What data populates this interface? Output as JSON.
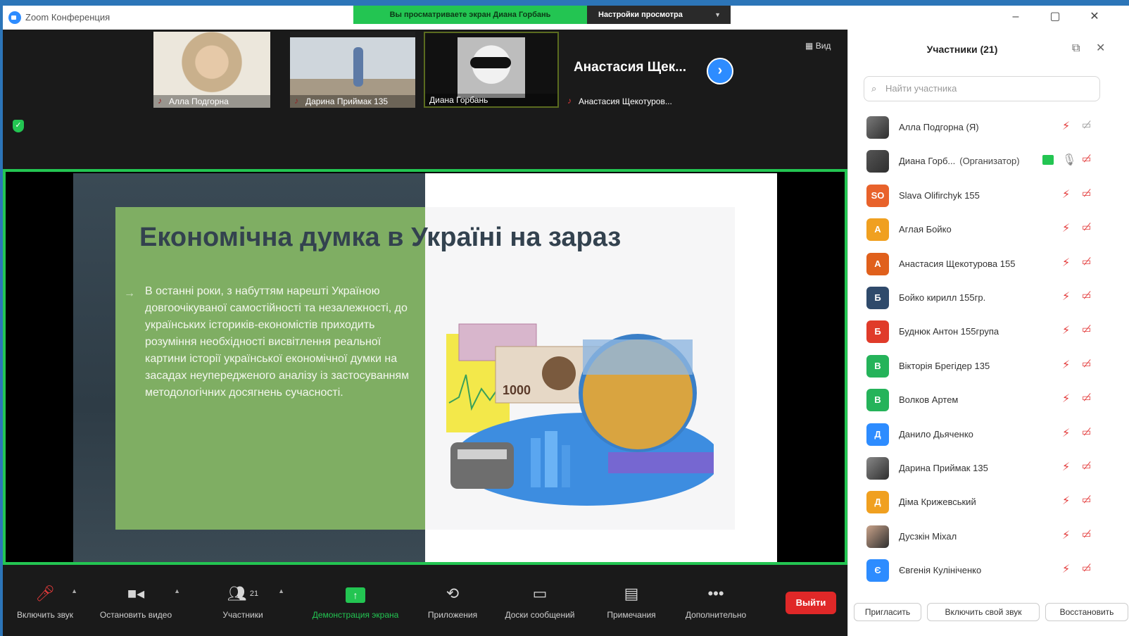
{
  "window": {
    "title": "Zoom Конференция",
    "view_banner": "Вы просматриваете экран Диана Горбань",
    "view_settings": "Настройки просмотра"
  },
  "video_strip": {
    "participants": [
      {
        "name": "Алла Подгорна"
      },
      {
        "name": "Дарина Приймак 135"
      },
      {
        "name": "Диана Горбань"
      },
      {
        "name": "Анастасия Щекотуров...",
        "display_name": "Анастасия  Щек..."
      }
    ],
    "view_label": "Вид"
  },
  "slide": {
    "title": "Економічна думка в Україні на зараз",
    "body": "В останні роки, з набуттям нарешті Україною довгоочікуваної самостійності та незалежності, до українських істориків-економістів приходить розуміння необхідності висвітлення реальної картини історії української економічної думки на засадах неупередженого аналізу із застосуванням методологічних досягнень сучасності.",
    "banknote_label": "1000"
  },
  "toolbar": {
    "items": [
      {
        "label": "Включить звук",
        "icon": "mic-muted-icon"
      },
      {
        "label": "Остановить видео",
        "icon": "video-camera-icon"
      },
      {
        "label": "Участники",
        "icon": "participants-icon",
        "count": "21"
      },
      {
        "label": "Демонстрация экрана",
        "icon": "share-screen-icon"
      },
      {
        "label": "Приложения",
        "icon": "apps-icon"
      },
      {
        "label": "Доски сообщений",
        "icon": "whiteboard-icon"
      },
      {
        "label": "Примечания",
        "icon": "notes-icon"
      },
      {
        "label": "Дополнительно",
        "icon": "more-icon"
      }
    ],
    "leave": "Выйти"
  },
  "panel": {
    "title": "Участники (21)",
    "search_placeholder": "Найти участника",
    "participants": [
      {
        "name": "Алла Подгорна (Я)",
        "avatar": "photo",
        "color": "#7a7a7a",
        "initial": ""
      },
      {
        "name": "Диана Горб...",
        "tag": "(Организатор)",
        "avatar": "photo",
        "color": "#555555",
        "initial": ""
      },
      {
        "name": "Slava Olifirchyk 155",
        "avatar": "initials",
        "color": "#e8622b",
        "initial": "SO"
      },
      {
        "name": "Аглая Бойко",
        "avatar": "initials",
        "color": "#f0a020",
        "initial": "А"
      },
      {
        "name": "Анастасия Щекотурова 155",
        "avatar": "initials",
        "color": "#e0601c",
        "initial": "А"
      },
      {
        "name": "Бойко кирилл 155гр.",
        "avatar": "initials",
        "color": "#2f4a6b",
        "initial": "Б"
      },
      {
        "name": "Буднюк Антон 155група",
        "avatar": "initials",
        "color": "#e03b2a",
        "initial": "Б"
      },
      {
        "name": "Вікторія Брегідер 135",
        "avatar": "initials",
        "color": "#25b35a",
        "initial": "В"
      },
      {
        "name": "Волков Артем",
        "avatar": "initials",
        "color": "#25b35a",
        "initial": "В"
      },
      {
        "name": "Данило Дьяченко",
        "avatar": "initials",
        "color": "#2d8cff",
        "initial": "Д"
      },
      {
        "name": "Дарина Приймак 135",
        "avatar": "photo",
        "color": "#888888",
        "initial": ""
      },
      {
        "name": "Діма Крижевський",
        "avatar": "initials",
        "color": "#f0a020",
        "initial": "Д"
      },
      {
        "name": "Дусзкін Міхал",
        "avatar": "photo",
        "color": "#c9a38a",
        "initial": ""
      },
      {
        "name": "Євгенія Кулініченко",
        "avatar": "initials",
        "color": "#2d8cff",
        "initial": "Є"
      }
    ],
    "footer": {
      "invite": "Пригласить",
      "unmute_me": "Включить свой звук",
      "restore": "Восстановить"
    }
  },
  "colors": {
    "zoom_green": "#23c552",
    "zoom_blue": "#2d8cff",
    "leave_red": "#e02828",
    "slide_green": "#7fae63"
  }
}
